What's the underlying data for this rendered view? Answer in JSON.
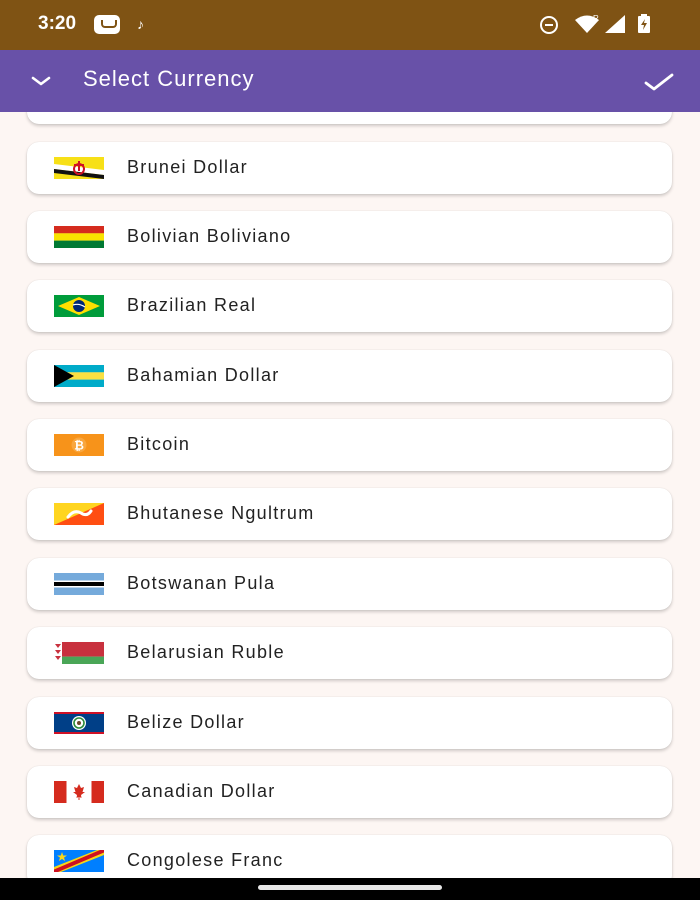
{
  "status_bar": {
    "time": "3:20",
    "icons": [
      "messaging-app-icon",
      "tiktok-icon",
      "do-not-disturb-icon",
      "wifi-icon",
      "signal-icon",
      "battery-icon"
    ],
    "roaming_label": "R"
  },
  "app_bar": {
    "title": "Select Currency",
    "background": "#6851a8",
    "left_icon": "chevron-down-icon",
    "right_icon": "checkmark-icon"
  },
  "currencies": [
    {
      "name": "Brunei Dollar",
      "flag": "brunei-flag-icon"
    },
    {
      "name": "Bolivian Boliviano",
      "flag": "bolivia-flag-icon"
    },
    {
      "name": "Brazilian Real",
      "flag": "brazil-flag-icon"
    },
    {
      "name": "Bahamian Dollar",
      "flag": "bahamas-flag-icon"
    },
    {
      "name": "Bitcoin",
      "flag": "bitcoin-icon"
    },
    {
      "name": "Bhutanese Ngultrum",
      "flag": "bhutan-flag-icon"
    },
    {
      "name": "Botswanan Pula",
      "flag": "botswana-flag-icon"
    },
    {
      "name": "Belarusian Ruble",
      "flag": "belarus-flag-icon"
    },
    {
      "name": "Belize Dollar",
      "flag": "belize-flag-icon"
    },
    {
      "name": "Canadian Dollar",
      "flag": "canada-flag-icon"
    },
    {
      "name": "Congolese Franc",
      "flag": "dr-congo-flag-icon"
    }
  ]
}
